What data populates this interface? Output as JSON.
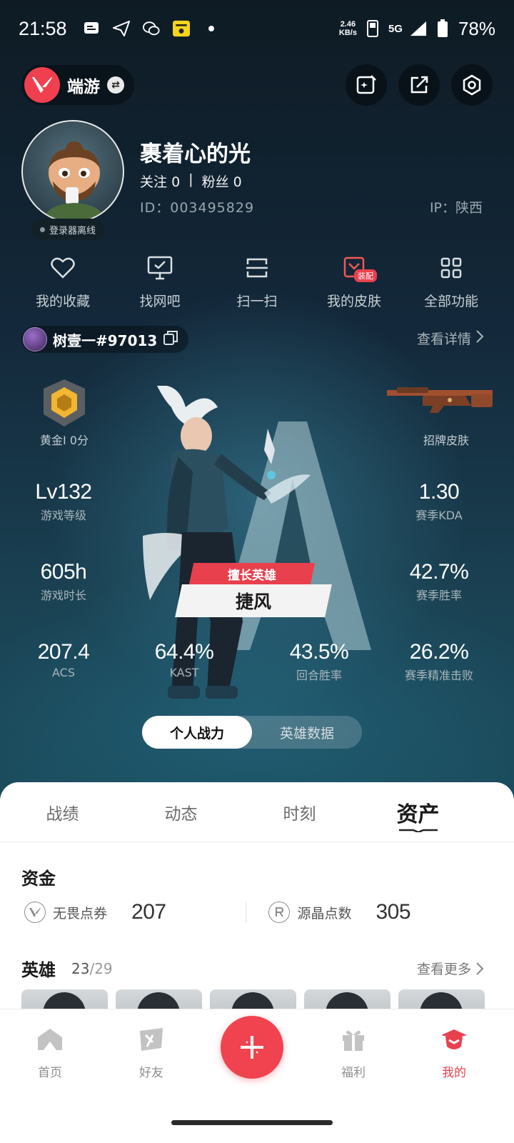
{
  "status_bar": {
    "time": "21:58",
    "net_speed_value": "2.46",
    "net_speed_unit": "KB/s",
    "network": "5G",
    "battery": "78%"
  },
  "topbar": {
    "game_label": "端游"
  },
  "profile": {
    "nickname": "裹着心的光",
    "follow_label": "关注",
    "follow_count": "0",
    "separator": "|",
    "fans_label": "粉丝",
    "fans_count": "0",
    "id_text": "ID：003495829",
    "ip_text": "IP：陕西",
    "status": "登录器离线"
  },
  "quick_actions": [
    {
      "label": "我的收藏"
    },
    {
      "label": "找网吧"
    },
    {
      "label": "扫一扫"
    },
    {
      "label": "我的皮肤",
      "badge": "装配"
    },
    {
      "label": "全部功能"
    }
  ],
  "account": {
    "name": "树壹一#97013",
    "view_detail": "查看详情"
  },
  "stats": {
    "rank": "黄金I 0分",
    "skin": "招牌皮肤",
    "level_val": "Lv132",
    "level_lbl": "游戏等级",
    "kda_val": "1.30",
    "kda_lbl": "赛季KDA",
    "time_val": "605h",
    "time_lbl": "游戏时长",
    "winrate_val": "42.7%",
    "winrate_lbl": "赛季胜率",
    "acs_val": "207.4",
    "acs_lbl": "ACS",
    "kast_val": "64.4%",
    "kast_lbl": "KAST",
    "round_val": "43.5%",
    "round_lbl": "回合胜率",
    "precision_val": "26.2%",
    "precision_lbl": "赛季精准击败"
  },
  "hero": {
    "tag": "擅长英雄",
    "name": "捷风"
  },
  "segment": {
    "tab1": "个人战力",
    "tab2": "英雄数据",
    "active": "个人战力"
  },
  "sheet": {
    "tabs": [
      "战绩",
      "动态",
      "时刻",
      "资产"
    ],
    "active_tab": "资产",
    "funds_title": "资金",
    "fund1_label": "无畏点券",
    "fund1_val": "207",
    "fund2_label": "源晶点数",
    "fund2_val": "305",
    "heroes_title": "英雄",
    "heroes_count": "23",
    "heroes_total": "/29",
    "view_more": "查看更多"
  },
  "bottom_nav": {
    "items": [
      "首页",
      "好友",
      "福利",
      "我的"
    ],
    "active": "我的"
  },
  "colors": {
    "accent": "#f0434f",
    "gold": "#f2b632"
  }
}
